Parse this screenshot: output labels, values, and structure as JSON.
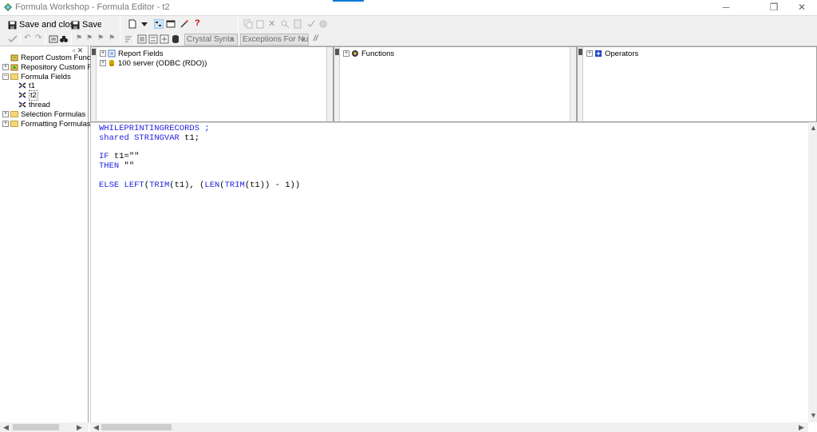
{
  "window": {
    "title": "Formula Workshop - Formula Editor - t2",
    "minimize": "─",
    "restore": "❐",
    "close": "✕"
  },
  "toolbar": {
    "save_close_label": "Save and close",
    "save_label": "Save",
    "syntax_combo": "Crystal Synta",
    "exceptions_combo": "Exceptions For Nu",
    "comment_label": "//"
  },
  "left_tree": {
    "items": [
      {
        "label": "Report Custom Funct",
        "expanded": false
      },
      {
        "label": "Repository Custom Fu",
        "expanded": false
      },
      {
        "label": "Formula Fields",
        "expanded": true
      },
      {
        "label": "t1"
      },
      {
        "label": "t2"
      },
      {
        "label": "thread"
      },
      {
        "label": "Selection Formulas",
        "expanded": false
      },
      {
        "label": "Formatting Formulas",
        "expanded": false
      }
    ]
  },
  "panes": {
    "fields": {
      "items": [
        "Report Fields",
        "100 server (ODBC (RDO))"
      ]
    },
    "functions": {
      "items": [
        "Functions"
      ]
    },
    "operators": {
      "items": [
        "Operators"
      ]
    }
  },
  "editor": {
    "lines": [
      "WHILEPRINTINGRECORDS ;",
      "shared STRINGVAR t1;",
      "",
      "IF t1=\"\"",
      "THEN \"\"",
      "",
      "ELSE LEFT(TRIM(t1), (LEN(TRIM(t1)) - 1))"
    ]
  },
  "colors": {
    "keyword": "#1f1fe0",
    "accent": "#0078d7"
  }
}
